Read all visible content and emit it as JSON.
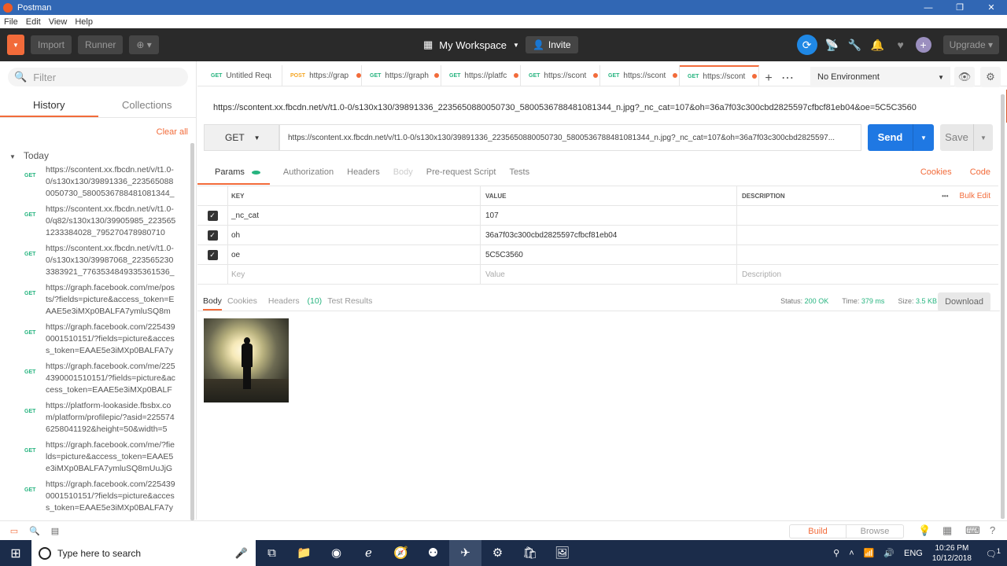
{
  "window": {
    "title": "Postman",
    "min": "—",
    "max": "❐",
    "close": "✕"
  },
  "menu": [
    "File",
    "Edit",
    "View",
    "Help"
  ],
  "header": {
    "new_label": "New",
    "import_label": "Import",
    "runner_label": "Runner",
    "workspace_label": "My Workspace",
    "invite_label": "Invite",
    "upgrade_label": "Upgrade"
  },
  "sidebar": {
    "filter_placeholder": "Filter",
    "tab_history": "History",
    "tab_collections": "Collections",
    "clear_all": "Clear all",
    "group_label": "Today",
    "items": [
      {
        "method": "GET",
        "url": "https://scontent.xx.fbcdn.net/v/t1.0-0/s130x130/39891336_2235650880050730_5800536788481081344_"
      },
      {
        "method": "GET",
        "url": "https://scontent.xx.fbcdn.net/v/t1.0-0/q82/s130x130/39905985_2235651233384028_795270478980710"
      },
      {
        "method": "GET",
        "url": "https://scontent.xx.fbcdn.net/v/t1.0-0/s130x130/39987068_2235652303383921_7763534849335361536_"
      },
      {
        "method": "GET",
        "url": "https://graph.facebook.com/me/posts/?fields=picture&access_token=EAAE5e3iMXp0BALFA7ymluSQ8mU"
      },
      {
        "method": "GET",
        "url": "https://graph.facebook.com/2254390001510151/?fields=picture&access_token=EAAE5e3iMXp0BALFA7y"
      },
      {
        "method": "GET",
        "url": "https://graph.facebook.com/me/2254390001510151/?fields=picture&access_token=EAAE5e3iMXp0BALF"
      },
      {
        "method": "GET",
        "url": "https://platform-lookaside.fbsbx.com/platform/profilepic/?asid=2255746258041192&height=50&width=5"
      },
      {
        "method": "GET",
        "url": "https://graph.facebook.com/me/?fields=picture&access_token=EAAE5e3iMXp0BALFA7ymluSQ8mUuJjGwJ"
      },
      {
        "method": "GET",
        "url": "https://graph.facebook.com/2254390001510151/?fields=picture&access_token=EAAE5e3iMXp0BALFA7y"
      }
    ]
  },
  "tabs": [
    {
      "method": "GET",
      "title": "Untitled Reques",
      "dot": false
    },
    {
      "method": "POST",
      "title": "https://grap",
      "dot": true
    },
    {
      "method": "GET",
      "title": "https://graph",
      "dot": true
    },
    {
      "method": "GET",
      "title": "https://platfc",
      "dot": true
    },
    {
      "method": "GET",
      "title": "https://scont",
      "dot": true
    },
    {
      "method": "GET",
      "title": "https://scont",
      "dot": true
    },
    {
      "method": "GET",
      "title": "https://scont",
      "dot": true
    }
  ],
  "environment": "No Environment",
  "request": {
    "title_url": "https://scontent.xx.fbcdn.net/v/t1.0-0/s130x130/39891336_2235650880050730_5800536788481081344_n.jpg?_nc_cat=107&oh=36a7f03c300cbd2825597cfbcf81eb04&oe=5C5C3560",
    "method": "GET",
    "url": "https://scontent.xx.fbcdn.net/v/t1.0-0/s130x130/39891336_2235650880050730_5800536788481081344_n.jpg?_nc_cat=107&oh=36a7f03c300cbd2825597...",
    "send_label": "Send",
    "save_label": "Save"
  },
  "req_tabs": {
    "params": "Params",
    "authorization": "Authorization",
    "headers": "Headers",
    "body": "Body",
    "prerequest": "Pre-request Script",
    "tests": "Tests",
    "cookies": "Cookies",
    "code": "Code"
  },
  "params": {
    "col_key": "KEY",
    "col_value": "VALUE",
    "col_desc": "DESCRIPTION",
    "bulk_edit": "Bulk Edit",
    "more": "•••",
    "rows": [
      {
        "key": "_nc_cat",
        "value": "107"
      },
      {
        "key": "oh",
        "value": "36a7f03c300cbd2825597cfbcf81eb04"
      },
      {
        "key": "oe",
        "value": "5C5C3560"
      }
    ],
    "ph_key": "Key",
    "ph_value": "Value",
    "ph_desc": "Description"
  },
  "response": {
    "tab_body": "Body",
    "tab_cookies": "Cookies",
    "tab_headers": "Headers",
    "headers_count": "(10)",
    "tab_tests": "Test Results",
    "status_label": "Status:",
    "status_value": "200 OK",
    "time_label": "Time:",
    "time_value": "379 ms",
    "size_label": "Size:",
    "size_value": "3.5 KB",
    "download_label": "Download"
  },
  "statusbar": {
    "build": "Build",
    "browse": "Browse"
  },
  "taskbar": {
    "search_placeholder": "Type here to search",
    "lang": "ENG",
    "time": "10:26 PM",
    "date": "10/12/2018",
    "notif_count": "1"
  }
}
